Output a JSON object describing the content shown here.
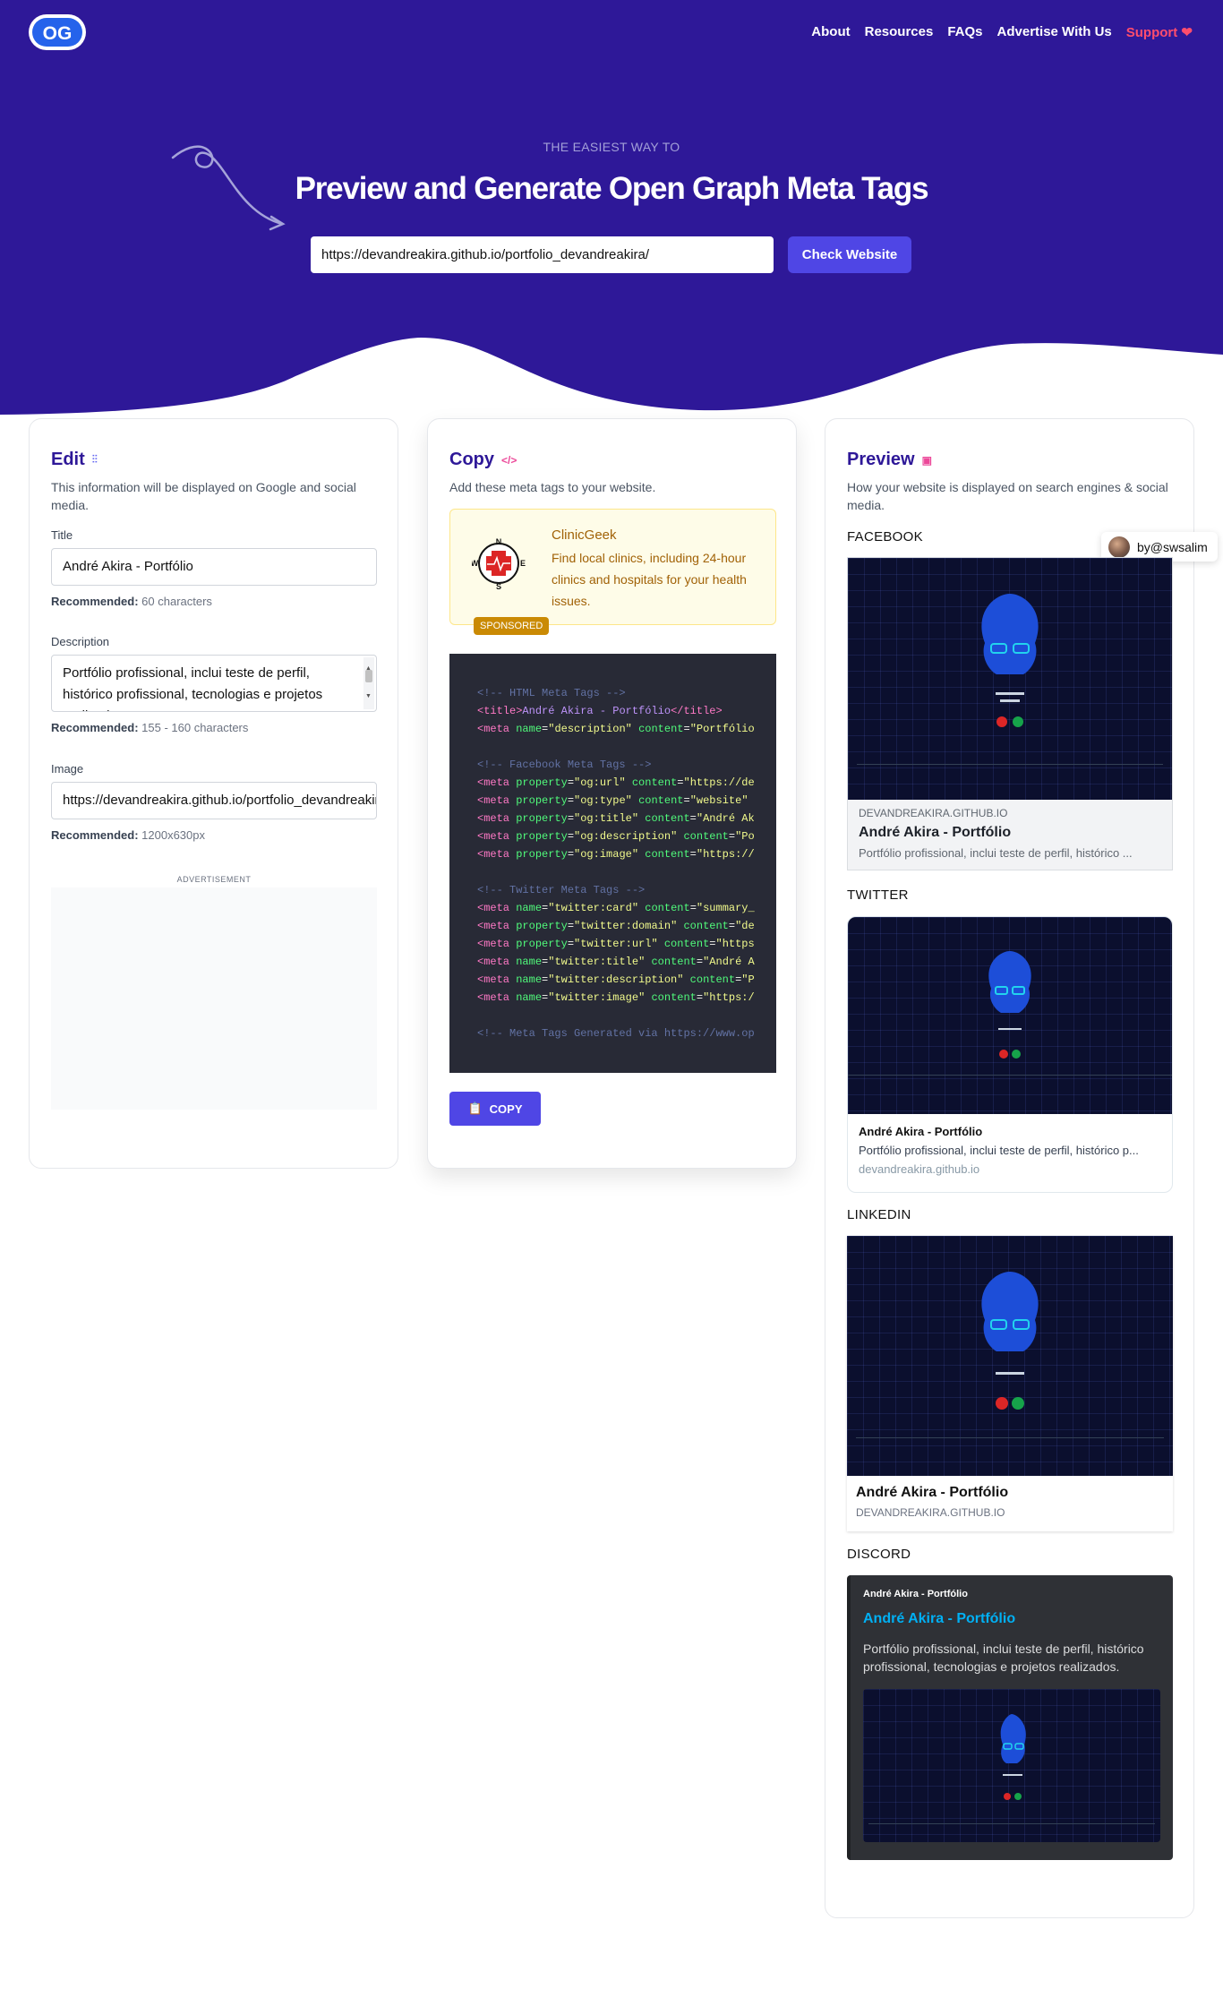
{
  "nav": {
    "logo": "OG",
    "links": [
      "About",
      "Resources",
      "FAQs",
      "Advertise With Us"
    ],
    "support": "Support"
  },
  "hero": {
    "eyebrow": "THE EASIEST WAY TO",
    "title": "Preview and Generate Open Graph Meta Tags",
    "url_value": "https://devandreakira.github.io/portfolio_devandreakira/",
    "check_button": "Check Website"
  },
  "edit": {
    "title": "Edit",
    "subtitle": "This information will be displayed on Google and social media.",
    "title_label": "Title",
    "title_value": "André Akira - Portfólio",
    "title_rec_label": "Recommended:",
    "title_rec_value": "60 characters",
    "desc_label": "Description",
    "desc_value": "Portfólio profissional, inclui teste de perfil, histórico profissional, tecnologias e projetos realizados.",
    "desc_rec_label": "Recommended:",
    "desc_rec_value": "155 - 160 characters",
    "image_label": "Image",
    "image_value": "https://devandreakira.github.io/portfolio_devandreakira/",
    "image_rec_label": "Recommended:",
    "image_rec_value": "1200x630px",
    "ad_label": "ADVERTISEMENT"
  },
  "copy": {
    "title": "Copy",
    "subtitle": "Add these meta tags to your website.",
    "sponsor_name": "ClinicGeek",
    "sponsor_text": "Find local clinics, including 24-hour clinics and hospitals for your health issues.",
    "sponsor_badge": "SPONSORED",
    "copy_button": "COPY",
    "code": {
      "c1": "<!-- HTML Meta Tags -->",
      "title_text": "André Akira - Portfólio",
      "l_desc_name": "description",
      "l_desc_content": "Portfólio",
      "c2": "<!-- Facebook Meta Tags -->",
      "og_url": "og:url",
      "og_url_v": "https://de",
      "og_type": "og:type",
      "og_type_v": "website",
      "og_title": "og:title",
      "og_title_v": "André Ak",
      "og_desc": "og:description",
      "og_desc_v": "Po",
      "og_image": "og:image",
      "og_image_v": "https://",
      "c3": "<!-- Twitter Meta Tags -->",
      "tw_card": "twitter:card",
      "tw_card_v": "summary_",
      "tw_domain": "twitter:domain",
      "tw_domain_v": "de",
      "tw_url": "twitter:url",
      "tw_url_v": "https",
      "tw_title": "twitter:title",
      "tw_title_v": "André A",
      "tw_desc": "twitter:description",
      "tw_desc_v": "P",
      "tw_image": "twitter:image",
      "tw_image_v": "https:/",
      "c4": "<!-- Meta Tags Generated via https://www.op"
    }
  },
  "preview": {
    "title": "Preview",
    "subtitle": "How your website is displayed on search engines & social media.",
    "byline": "by@swsalim",
    "facebook_label": "FACEBOOK",
    "fb_domain": "DEVANDREAKIRA.GITHUB.IO",
    "fb_title": "André Akira - Portfólio",
    "fb_desc": "Portfólio profissional, inclui teste de perfil, histórico ...",
    "twitter_label": "TWITTER",
    "tw_title": "André Akira - Portfólio",
    "tw_desc": "Portfólio profissional, inclui teste de perfil, histórico p...",
    "tw_domain": "devandreakira.github.io",
    "linkedin_label": "LINKEDIN",
    "li_title": "André Akira - Portfólio",
    "li_domain": "DEVANDREAKIRA.GITHUB.IO",
    "discord_label": "DISCORD",
    "dc_site": "André Akira - Portfólio",
    "dc_title": "André Akira - Portfólio",
    "dc_desc": "Portfólio profissional, inclui teste de perfil, histórico profissional, tecnologias e projetos realizados."
  },
  "colors": {
    "hero_bg": "#2e1898",
    "accent": "#4f46e5",
    "support": "#ff4d6d",
    "sponsor_bg": "#fefce8",
    "code_bg": "#282a36"
  },
  "icons": [
    "og-logo",
    "heart-icon",
    "sliders-icon",
    "code-icon",
    "image-icon",
    "clipboard-icon",
    "clinic-compass-logo",
    "avatar"
  ]
}
